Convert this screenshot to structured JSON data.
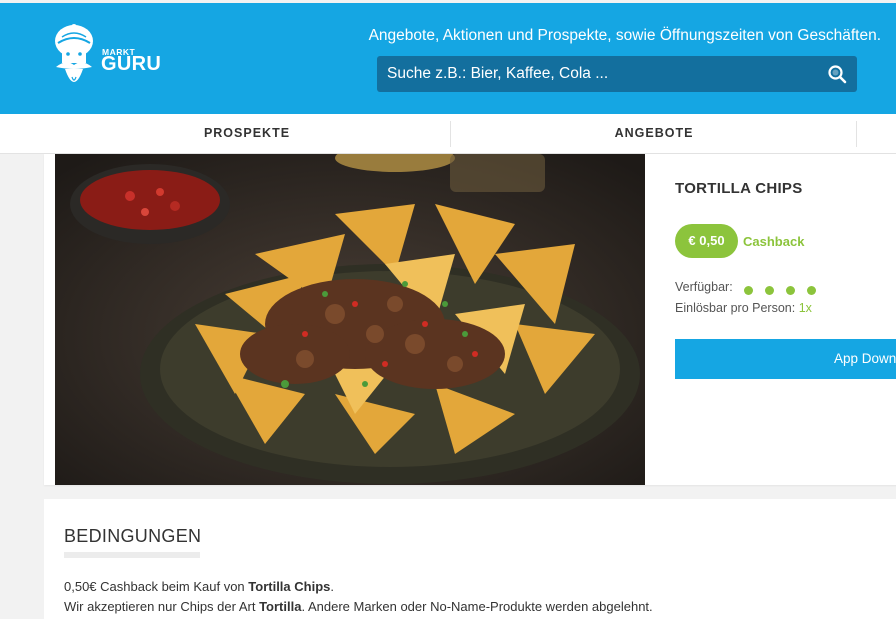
{
  "header": {
    "logo_small": "MARKT",
    "logo_big": "GURU",
    "tagline": "Angebote, Aktionen und Prospekte, sowie Öffnungszeiten von Geschäften.",
    "search_placeholder": "Suche z.B.: Bier, Kaffee, Cola ...",
    "search_icon": "search-icon",
    "brand_color": "#15a6e3"
  },
  "nav": {
    "tabs": [
      {
        "label": "PROSPEKTE"
      },
      {
        "label": "ANGEBOTE"
      }
    ]
  },
  "product": {
    "image_alt": "Tortilla Chips Nachos",
    "title": "TORTILLA CHIPS",
    "price": "€ 0,50",
    "cashback_label": "Cashback",
    "available_label": "Verfügbar:",
    "availability_dots": 4,
    "limit_label": "Einlösbar pro Person:",
    "limit_value": "1x",
    "app_button": "App Down",
    "accent_color": "#8cc43c"
  },
  "conditions": {
    "title": "BEDINGUNGEN",
    "line1_prefix": "0,50€ Cashback beim Kauf von ",
    "line1_bold": "Tortilla Chips",
    "line1_suffix": ".",
    "line2_prefix": "Wir akzeptieren nur Chips der Art ",
    "line2_bold": "Tortilla",
    "line2_suffix": ". Andere Marken oder No-Name-Produkte werden abgelehnt."
  }
}
